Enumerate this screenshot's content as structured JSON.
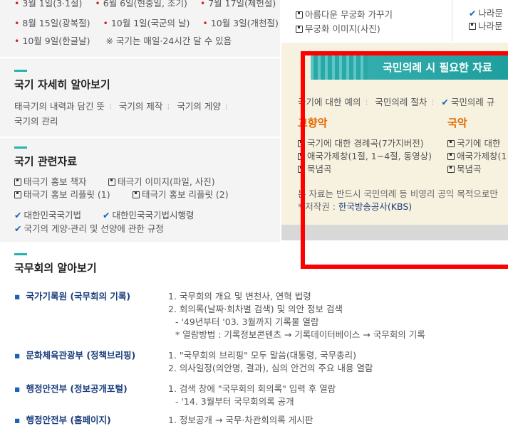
{
  "holidays": {
    "row1": [
      "3월 1일(3·1절)",
      "6월 6일(현충일, 조기)",
      "7월 17일(제헌절)"
    ],
    "row2": [
      "8월 15일(광복절)",
      "10월 1일(국군의 날)",
      "10월 3일(개천절)"
    ],
    "row3_item": "10월 9일(한글날)",
    "note": "※ 국기는 매일·24시간 달 수 있음"
  },
  "flower": {
    "items": [
      "아름다운 무궁화 가꾸기",
      "무궁화 이미지(사진)"
    ],
    "right_items": [
      "나라문",
      "나라문"
    ]
  },
  "detail": {
    "title": "국기 자세히 알아보기",
    "links": [
      "태극기의 내력과 담긴 뜻",
      "국기의 제작",
      "국기의 게양",
      "국기의 관리"
    ]
  },
  "related": {
    "title": "국기 관련자료",
    "files": [
      [
        "태극기 홍보 책자",
        "태극기 이미지(파일, 사진)"
      ],
      [
        "태극기 홍보 리플릿 (1)",
        "태극기 홍보 리플릿 (2)"
      ]
    ],
    "laws": [
      "대한민국국기법",
      "대한민국국기법시행령",
      "국기의 게양·관리 및 선양에 관한 규정"
    ]
  },
  "ceremony": {
    "banner": "국민의례 시 필요한 자료",
    "tabs": [
      "국기에 대한 예의",
      "국민의례 절차",
      "국민의례 규"
    ],
    "left_heading": "교향악",
    "right_heading": "국악",
    "left_items": [
      "국기에 대한 경례곡(7가지버전)",
      "애국가제창(1절, 1~4절, 동영상)",
      "묵념곡"
    ],
    "right_items": [
      "국기에 대한",
      "애국가제창(1",
      "묵념곡"
    ],
    "note1": "본 자료는 반드시 국민의례 등 비영리 공익 목적으로만",
    "note2_prefix": "* 저작권 : ",
    "note2_link": "한국방송공사(KBS)"
  },
  "cabinet": {
    "title": "국무회의 알아보기",
    "sections": [
      {
        "label": "국가기록원 (국무회의 기록)",
        "lines": [
          "1. 국무회의 개요 및 변천사, 연혁 법령",
          "2. 회의록(날짜·회차별 검색) 및 의안 정보 검색",
          "- '49년부터 '03. 3월까지 기록물 열람",
          "* 열람방법 : 기록정보콘텐츠 → 기록데이터베이스 → 국무회의 기록"
        ]
      },
      {
        "label": "문화체육관광부 (정책브리핑)",
        "lines": [
          "1. \"국무회의 브리핑\" 모두 말씀(대통령, 국무총리)",
          "2. 의사일정(의안명, 결과), 심의 안건의 주요 내용 열람"
        ]
      },
      {
        "label": "행정안전부 (정보공개포털)",
        "lines": [
          "1. 검색 창에 \"국무회의 회의록\" 입력 후 열람",
          "- '14. 3월부터 국무회의록 공개"
        ]
      },
      {
        "label": "행정안전부 (홈페이지)",
        "lines": [
          "1. 정보공개 → 국무·차관회의록 게시판"
        ]
      }
    ]
  },
  "colors": {
    "accent": "#26b2b2",
    "red_frame": "#ff0000",
    "link_blue": "#1a3d7c",
    "orange": "#e06a00"
  }
}
